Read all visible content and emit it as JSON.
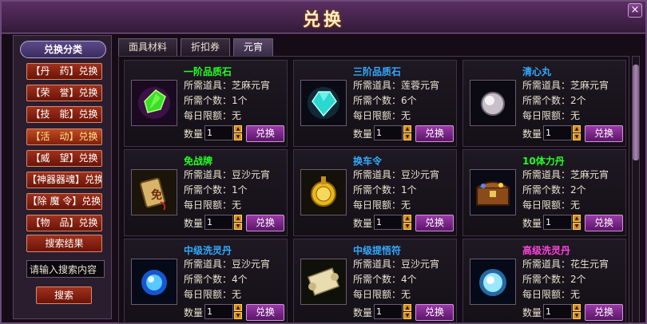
{
  "window": {
    "title": "兑换",
    "close_label": "×"
  },
  "sidebar": {
    "header": "兑换分类",
    "categories": [
      "【丹　药】兑换",
      "【荣　誉】兑换",
      "【技　能】兑换",
      "【活　动】兑换",
      "【威　望】兑换",
      "【神器器魂】兑换",
      "【除 魔 令】兑换",
      "【物　品】兑换"
    ],
    "search_result_label": "搜索结果",
    "search_placeholder": "请输入搜索内容",
    "search_button": "搜索"
  },
  "tabs": [
    "面具材料",
    "折扣券",
    "元宵"
  ],
  "labels": {
    "required_item": "所需道具：",
    "required_count": "所需个数：",
    "daily_limit": "每日限额：",
    "qty": "数量",
    "exchange": "兑换"
  },
  "items": [
    {
      "name": "一阶品质石",
      "color": "#22ff22",
      "icon": "green-crystal-icon",
      "required_item": "芝麻元宵",
      "required_count": "1个",
      "daily_limit": "无",
      "qty": "1"
    },
    {
      "name": "三阶品质石",
      "color": "#33aaff",
      "icon": "cyan-gem-icon",
      "required_item": "莲蓉元宵",
      "required_count": "6个",
      "daily_limit": "无",
      "qty": "1"
    },
    {
      "name": "清心丸",
      "color": "#33aaff",
      "icon": "pearl-pill-icon",
      "required_item": "芝麻元宵",
      "required_count": "2个",
      "daily_limit": "无",
      "qty": "1"
    },
    {
      "name": "免战牌",
      "color": "#22ff22",
      "icon": "truce-token-icon",
      "required_item": "豆沙元宵",
      "required_count": "1个",
      "daily_limit": "无",
      "qty": "1"
    },
    {
      "name": "换车令",
      "color": "#33aaff",
      "icon": "gold-medal-icon",
      "required_item": "豆沙元宵",
      "required_count": "1个",
      "daily_limit": "无",
      "qty": "1"
    },
    {
      "name": "10体力丹",
      "color": "#22ff22",
      "icon": "treasure-chest-icon",
      "required_item": "芝麻元宵",
      "required_count": "2个",
      "daily_limit": "无",
      "qty": "1"
    },
    {
      "name": "中级洗灵丹",
      "color": "#33aaff",
      "icon": "blue-orb-icon",
      "required_item": "豆沙元宵",
      "required_count": "4个",
      "daily_limit": "无",
      "qty": "1"
    },
    {
      "name": "中级提悟符",
      "color": "#33aaff",
      "icon": "scroll-icon",
      "required_item": "豆沙元宵",
      "required_count": "4个",
      "daily_limit": "无",
      "qty": "1"
    },
    {
      "name": "高级洗灵丹",
      "color": "#ff44dd",
      "icon": "bright-orb-icon",
      "required_item": "花生元宵",
      "required_count": "2个",
      "daily_limit": "无",
      "qty": "1"
    }
  ]
}
